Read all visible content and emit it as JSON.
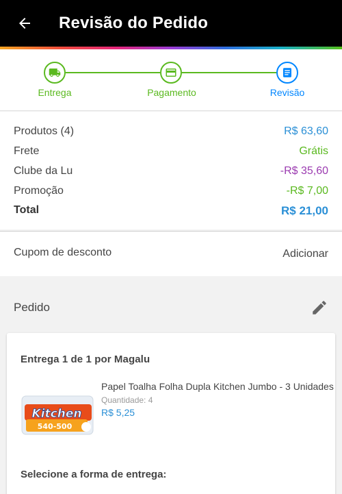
{
  "header": {
    "title": "Revisão do Pedido",
    "back_icon": "arrow-left-icon"
  },
  "stepper": {
    "steps": [
      {
        "label": "Entrega",
        "icon": "truck-icon",
        "state": "done"
      },
      {
        "label": "Pagamento",
        "icon": "credit-card-icon",
        "state": "done"
      },
      {
        "label": "Revisão",
        "icon": "document-list-icon",
        "state": "active"
      }
    ]
  },
  "summary": {
    "rows": [
      {
        "label": "Produtos (4)",
        "value": "R$ 63,60"
      },
      {
        "label": "Frete",
        "value": "Grátis"
      },
      {
        "label": "Clube da Lu",
        "value": "-R$ 35,60"
      },
      {
        "label": "Promoção",
        "value": "-R$ 7,00"
      },
      {
        "label": "Total",
        "value": "R$ 21,00"
      }
    ]
  },
  "coupon": {
    "label": "Cupom de desconto",
    "action": "Adicionar"
  },
  "order": {
    "title": "Pedido",
    "edit_icon": "pencil-icon",
    "delivery": {
      "title": "Entrega 1 de 1 por Magalu",
      "product": {
        "name": "Papel Toalha Folha Dupla Kitchen Jumbo - 3 Unidades",
        "quantity_label": "Quantidade:",
        "quantity": "4",
        "price": "R$ 5,25",
        "image_brand": "Kitchen",
        "image_badge": "540-500"
      },
      "select_label": "Selecione a forma de entrega:"
    }
  },
  "colors": {
    "accent_green": "#5ab91f",
    "accent_blue": "#0086ff",
    "price_blue": "#2a8fd6",
    "discount_purple": "#9b3bb0"
  }
}
